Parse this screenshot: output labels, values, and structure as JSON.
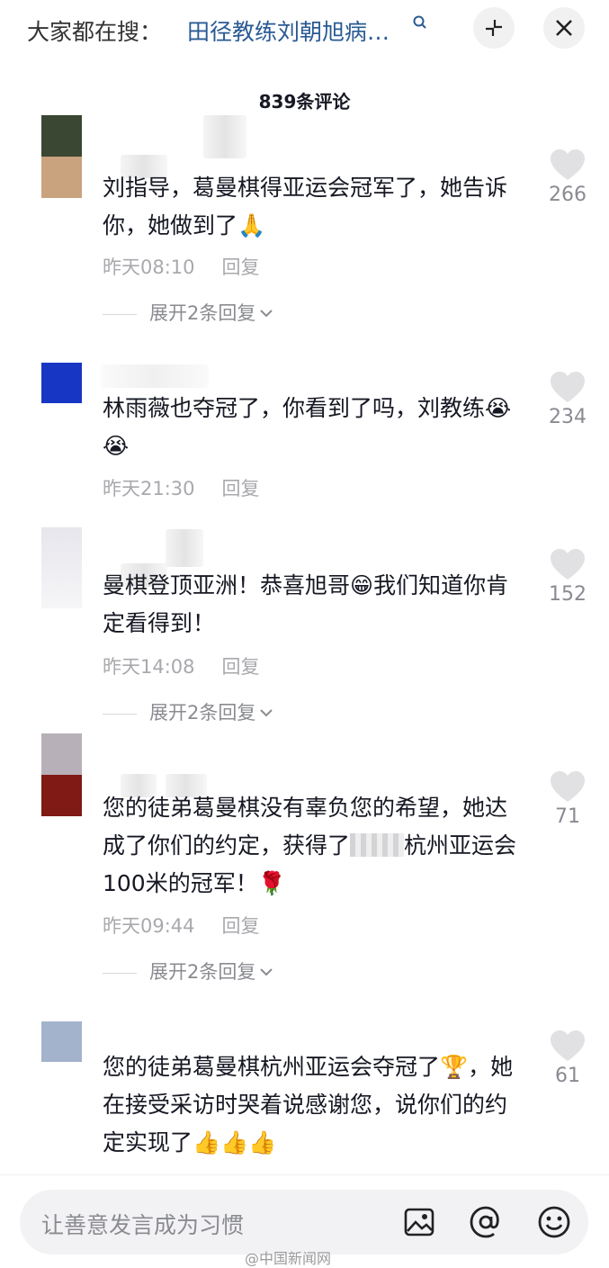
{
  "search": {
    "prefix": "大家都在搜：",
    "query": "田径教练刘朝旭病…"
  },
  "comment_count_title": "839条评论",
  "comments": [
    {
      "text": "刘指导，葛曼棋得亚运会冠军了，她告诉你，她做到了",
      "emoji": "🙏",
      "time": "昨天08:10",
      "reply_label": "回复",
      "likes": "266",
      "expand_label": "展开2条回复"
    },
    {
      "text": "林雨薇也夺冠了，你看到了吗，刘教练",
      "emoji": "😭😭",
      "time": "昨天21:30",
      "reply_label": "回复",
      "likes": "234"
    },
    {
      "text": "曼棋登顶亚洲！恭喜旭哥",
      "text2": "我们知道你肯定看得到！",
      "emoji": "😁",
      "time": "昨天14:08",
      "reply_label": "回复",
      "likes": "152",
      "expand_label": "展开2条回复"
    },
    {
      "text": "您的徒弟葛曼棋没有辜负您的希望，她达成了你们的约定，获得了",
      "text2": "杭州亚运会100米的冠军！",
      "emoji": "🌹",
      "time": "昨天09:44",
      "reply_label": "回复",
      "likes": "71",
      "expand_label": "展开2条回复"
    },
    {
      "text": "您的徒弟葛曼棋杭州亚运会夺冠了",
      "text2": "，她在接受采访时哭着说感谢您，说你们的约定实现了",
      "emoji_a": "🏆",
      "emoji": "👍👍👍",
      "likes": "61"
    }
  ],
  "input": {
    "placeholder": "让善意发言成为习惯"
  },
  "watermark": "@中国新闻网",
  "colors": {
    "accent_link": "#2a5b94",
    "text_primary": "#161823",
    "text_secondary": "#a8a9ad",
    "heart_gray": "#e1e1e3"
  },
  "icons": [
    "search-icon",
    "collapse-icon",
    "close-icon",
    "heart-icon",
    "image-icon",
    "at-icon",
    "emoji-icon",
    "chevron-down-icon"
  ]
}
